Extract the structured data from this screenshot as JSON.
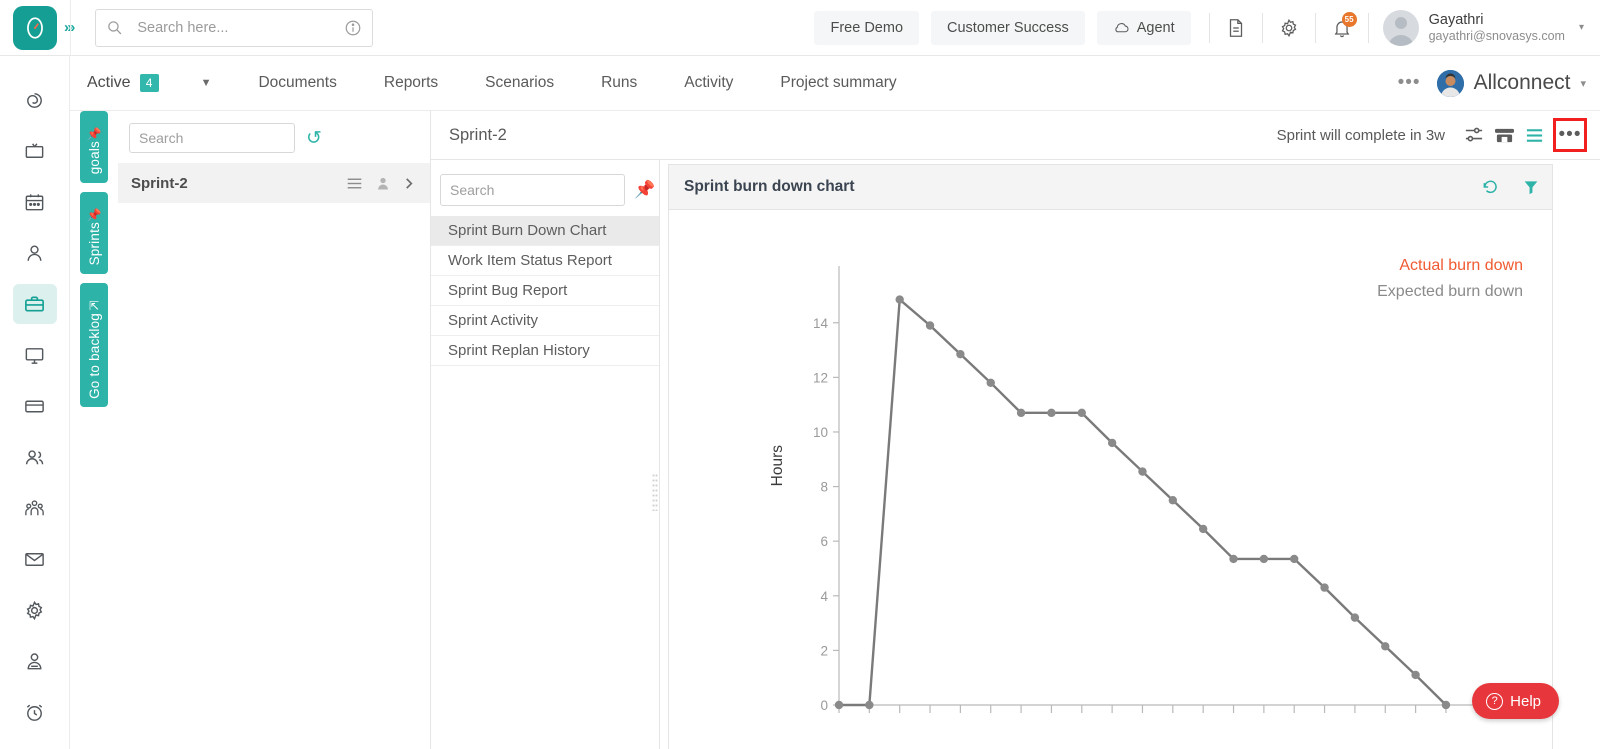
{
  "topbar": {
    "logo_icon": "clock-logo-icon",
    "expand_icon": "double-chevron-right-icon",
    "search": {
      "placeholder": "Search here...",
      "value": "",
      "icon": "search-icon",
      "info_icon": "info-circle-icon"
    },
    "buttons": [
      {
        "label": "Free Demo",
        "name": "free-demo-button",
        "icon": ""
      },
      {
        "label": "Customer Success",
        "name": "customer-success-button",
        "icon": ""
      },
      {
        "label": "Agent",
        "name": "agent-button",
        "icon": "cloud-icon"
      }
    ],
    "doc_icon": "document-icon",
    "gear_icon": "gear-icon",
    "bell_icon": "bell-icon",
    "bell_badge": "55",
    "user": {
      "name": "Gayathri",
      "email": "gayathri@snovasys.com",
      "avatar_icon": "user-avatar-icon",
      "caret": "▾"
    }
  },
  "navrow": {
    "active_label": "Active",
    "active_count": "4",
    "caret": "▼",
    "tabs": [
      {
        "label": "Documents"
      },
      {
        "label": "Reports"
      },
      {
        "label": "Scenarios"
      },
      {
        "label": "Runs"
      },
      {
        "label": "Activity"
      },
      {
        "label": "Project summary"
      }
    ],
    "more_dots": "•••",
    "org_name": "Allconnect",
    "org_caret": "▾"
  },
  "rail": {
    "items": [
      {
        "name": "sidebar-item-dashboard",
        "icon": "spiral-icon",
        "active": false
      },
      {
        "name": "sidebar-item-board",
        "icon": "tv-board-icon",
        "active": false
      },
      {
        "name": "sidebar-item-calendar",
        "icon": "calendar-icon",
        "active": false
      },
      {
        "name": "sidebar-item-profile",
        "icon": "person-icon",
        "active": false
      },
      {
        "name": "sidebar-item-projects",
        "icon": "briefcase-icon",
        "active": true
      },
      {
        "name": "sidebar-item-monitor",
        "icon": "monitor-icon",
        "active": false
      },
      {
        "name": "sidebar-item-billing",
        "icon": "credit-card-icon",
        "active": false
      },
      {
        "name": "sidebar-item-people",
        "icon": "two-people-icon",
        "active": false
      },
      {
        "name": "sidebar-item-teams",
        "icon": "group-people-icon",
        "active": false
      },
      {
        "name": "sidebar-item-mail",
        "icon": "envelope-icon",
        "active": false
      },
      {
        "name": "sidebar-item-settings",
        "icon": "gear-icon",
        "active": false
      },
      {
        "name": "sidebar-item-account",
        "icon": "user-badge-icon",
        "active": false
      },
      {
        "name": "sidebar-item-timer",
        "icon": "alarm-clock-icon",
        "active": false
      }
    ]
  },
  "vtabs": [
    {
      "label": "goals",
      "icon": "pin-icon"
    },
    {
      "label": "Sprints",
      "icon": "pin-icon"
    },
    {
      "label": "Go to backlog",
      "icon": "arrow-up-icon"
    }
  ],
  "sprint_panel": {
    "search": {
      "placeholder": "Search",
      "value": ""
    },
    "refresh_icon": "refresh-icon",
    "rows": [
      {
        "name": "Sprint-2",
        "menu_icon": "list-icon",
        "avatar_icon": "person-icon",
        "chevron_icon": "chevron-right-icon"
      }
    ]
  },
  "sprint_header": {
    "title": "Sprint-2",
    "status_text": "Sprint will complete in 3w",
    "icons": [
      {
        "name": "filter-sliders-icon"
      },
      {
        "name": "board-view-icon"
      },
      {
        "name": "list-view-icon"
      }
    ],
    "more_button": {
      "label": "•••",
      "name": "more-options-button",
      "highlight_color": "#f21f1f"
    }
  },
  "report_panel": {
    "search": {
      "placeholder": "Search",
      "value": ""
    },
    "pin_icon": "pin-icon",
    "items": [
      {
        "label": "Sprint Burn Down Chart",
        "selected": true
      },
      {
        "label": "Work Item Status Report",
        "selected": false
      },
      {
        "label": "Sprint Bug Report",
        "selected": false
      },
      {
        "label": "Sprint Activity",
        "selected": false
      },
      {
        "label": "Sprint Replan History",
        "selected": false
      }
    ]
  },
  "chart_panel": {
    "title": "Sprint burn down chart",
    "reset_icon": "refresh-icon",
    "filter_icon": "funnel-icon"
  },
  "chart_data": {
    "type": "line",
    "title": "Sprint burn down chart",
    "xlabel": "",
    "ylabel": "Hours",
    "ylim": [
      0,
      15.2
    ],
    "yticks": [
      0,
      2,
      4,
      6,
      8,
      10,
      12,
      14
    ],
    "grid": false,
    "legend_position": "top-right",
    "series": [
      {
        "name": "Actual burn down",
        "color": "#f05a31",
        "values": []
      },
      {
        "name": "Expected burn down",
        "color": "#808080",
        "x": [
          0,
          1,
          2,
          3,
          4,
          5,
          6,
          7,
          8,
          9,
          10,
          11,
          12,
          13,
          14,
          15,
          16,
          17,
          18,
          19,
          20,
          21,
          22
        ],
        "values": [
          0,
          0,
          14.85,
          13.9,
          12.85,
          11.8,
          10.7,
          10.7,
          10.7,
          9.6,
          8.55,
          7.5,
          6.45,
          5.35,
          5.35,
          5.35,
          4.3,
          3.2,
          2.15,
          1.1,
          0
        ]
      }
    ]
  },
  "help": {
    "label": "Help",
    "icon": "question-circle-icon",
    "color": "#e8373c"
  }
}
